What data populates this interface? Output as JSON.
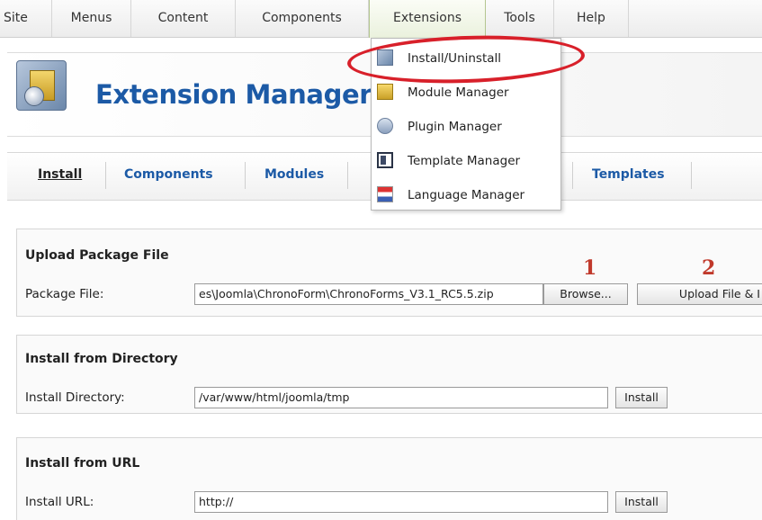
{
  "menubar": {
    "items": [
      "Site",
      "Menus",
      "Content",
      "Components",
      "Extensions",
      "Tools",
      "Help"
    ],
    "active": "Extensions"
  },
  "header": {
    "title": "Extension Manager",
    "icon": "extension-manager-icon"
  },
  "tabs": {
    "items": [
      "Install",
      "Components",
      "Modules",
      "Templates"
    ],
    "current": "Install"
  },
  "dropdown": {
    "items": [
      {
        "label": "Install/Uninstall",
        "icon": "install-icon"
      },
      {
        "label": "Module Manager",
        "icon": "module-icon"
      },
      {
        "label": "Plugin Manager",
        "icon": "plugin-icon"
      },
      {
        "label": "Template Manager",
        "icon": "template-icon"
      },
      {
        "label": "Language Manager",
        "icon": "language-icon"
      }
    ],
    "highlight_color": "#d8202a"
  },
  "upload": {
    "title": "Upload Package File",
    "label": "Package File:",
    "value": "es\\Joomla\\ChronoForm\\ChronoForms_V3.1_RC5.5.zip",
    "browse_label": "Browse...",
    "upload_label": "Upload File & I",
    "step1": "1",
    "step2": "2"
  },
  "directory": {
    "title": "Install from Directory",
    "label": "Install Directory:",
    "value": "/var/www/html/joomla/tmp",
    "button_label": "Install"
  },
  "url": {
    "title": "Install from URL",
    "label": "Install URL:",
    "value": "http://",
    "button_label": "Install"
  },
  "colors": {
    "title_blue": "#1c5aa6",
    "step_red": "#c0392b",
    "active_menu_green": "#eaf1dd"
  }
}
